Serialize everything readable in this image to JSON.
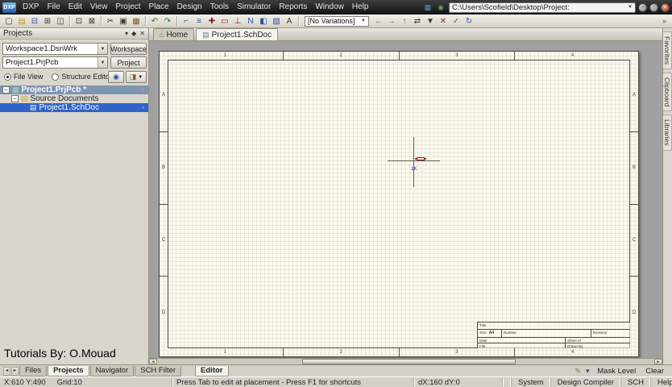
{
  "colors": {
    "selection_blue": "#2e63c8",
    "inactive_selection": "#7d96b4",
    "sheet_background": "#fbfaee",
    "canvas_gray": "#a0a0a0",
    "titlebar_background": "#1a1a1a"
  },
  "titlebar": {
    "logo": "DXP",
    "menus": [
      "DXP",
      "File",
      "Edit",
      "View",
      "Project",
      "Place",
      "Design",
      "Tools",
      "Simulator",
      "Reports",
      "Window",
      "Help"
    ],
    "quick_icons": [
      {
        "name": "workspace-quick-icon",
        "glyph": "▦",
        "color": "#5a8fd4"
      },
      {
        "name": "favorites-quick-icon",
        "glyph": "◉",
        "color": "#5fa05f"
      }
    ],
    "path_value": "C:\\Users\\Scofield\\Desktop\\Project:",
    "window_controls": [
      {
        "name": "minimize-button",
        "glyph": "–"
      },
      {
        "name": "restore-button",
        "glyph": "▫"
      },
      {
        "name": "close-button",
        "glyph": "✕",
        "type": "red"
      }
    ]
  },
  "toolbar": {
    "icons": [
      {
        "name": "new-document-icon",
        "glyph": "▢",
        "color": "#3b3b3b"
      },
      {
        "name": "open-document-icon",
        "glyph": "▤",
        "color": "#c9972c"
      },
      {
        "name": "save-icon",
        "glyph": "⊟",
        "color": "#35558f"
      },
      {
        "name": "print-icon",
        "glyph": "⊞",
        "color": "#3b3b3b"
      },
      {
        "name": "print-preview-icon",
        "glyph": "◫",
        "color": "#3b3b3b"
      },
      {
        "type": "sep",
        "name": "toolbar-separator"
      },
      {
        "name": "zoom-window-icon",
        "glyph": "⊡",
        "color": "#3b3b3b"
      },
      {
        "name": "zoom-fit-icon",
        "glyph": "⊠",
        "color": "#3b3b3b"
      },
      {
        "type": "sep",
        "name": "toolbar-separator"
      },
      {
        "name": "cut-icon",
        "glyph": "✂",
        "color": "#3b3b3b"
      },
      {
        "name": "copy-icon",
        "glyph": "▣",
        "color": "#3b3b3b"
      },
      {
        "name": "paste-icon",
        "glyph": "▦",
        "color": "#7a5c2e"
      },
      {
        "type": "sep",
        "name": "toolbar-separator"
      },
      {
        "name": "undo-icon",
        "glyph": "↶",
        "color": "#2f6e2f"
      },
      {
        "name": "redo-icon",
        "glyph": "↷",
        "color": "#2f6e2f"
      },
      {
        "type": "sep",
        "name": "toolbar-separator"
      },
      {
        "name": "place-wire-icon",
        "glyph": "⌐",
        "color": "#2a52a0"
      },
      {
        "name": "place-bus-icon",
        "glyph": "≡",
        "color": "#2a52a0"
      },
      {
        "name": "place-junction-icon",
        "glyph": "✚",
        "color": "#8b2020"
      },
      {
        "name": "place-part-icon",
        "glyph": "▭",
        "color": "#8b2020"
      },
      {
        "name": "place-power-port-icon",
        "glyph": "⊥",
        "color": "#8b2020"
      },
      {
        "name": "place-net-label-icon",
        "glyph": "N",
        "color": "#2a52a0"
      },
      {
        "name": "place-port-icon",
        "glyph": "◧",
        "color": "#2a52a0"
      },
      {
        "name": "place-sheet-symbol-icon",
        "glyph": "▧",
        "color": "#2a52a0"
      },
      {
        "name": "place-text-icon",
        "glyph": "A",
        "color": "#3b3b3b"
      },
      {
        "type": "sep",
        "name": "toolbar-separator"
      }
    ],
    "variations_value": "[No Variations]",
    "icons_right": [
      {
        "name": "navigate-back-icon",
        "glyph": "←",
        "color": "#2f7d2f"
      },
      {
        "name": "navigate-forward-icon",
        "glyph": "→",
        "color": "#2f7d2f"
      },
      {
        "name": "up-hierarchy-icon",
        "glyph": "↑",
        "color": "#2f7d2f"
      },
      {
        "name": "cross-probe-icon",
        "glyph": "⇄",
        "color": "#3b3b3b"
      },
      {
        "name": "filter-icon",
        "glyph": "▼",
        "color": "#3b3b3b"
      },
      {
        "name": "clear-filter-icon",
        "glyph": "✕",
        "color": "#a02020"
      },
      {
        "name": "compile-icon",
        "glyph": "✓",
        "color": "#2f7d2f"
      },
      {
        "name": "refresh-icon",
        "glyph": "↻",
        "color": "#2a52a0"
      }
    ],
    "overflow": "»"
  },
  "projects_panel": {
    "title": "Projects",
    "header_icons": [
      {
        "name": "chevron-down-icon",
        "glyph": "▾"
      },
      {
        "name": "pin-icon",
        "glyph": "◆"
      },
      {
        "name": "close-icon",
        "glyph": "✕"
      }
    ],
    "workspace_value": "Workspace1.DsnWrk",
    "workspace_button": "Workspace",
    "project_value": "Project1.PrjPcb",
    "project_button": "Project",
    "file_view_label": "File View",
    "structure_editor_label": "Structure Editor",
    "tree": [
      {
        "name": "tree-item-project1-prjpcb",
        "label": "Project1.PrjPcb *",
        "level": 0,
        "expander": "−",
        "icon": "▦",
        "right_icon": "▪",
        "bg": "#7d96b4",
        "color": "#ffffff",
        "type": "project-row"
      },
      {
        "name": "tree-item-source-documents",
        "label": "Source Documents",
        "level": 1,
        "expander": "−",
        "icon": "▤",
        "type": "folder-row"
      },
      {
        "name": "tree-item-project1-schdoc",
        "label": "Project1.SchDoc",
        "level": 2,
        "icon": "▤",
        "right_icon": "▫",
        "bg": "#2e63c8",
        "color": "#ffffff",
        "type": "sheet-row"
      }
    ],
    "watermark": "Tutorials By: O.Mouad"
  },
  "doc_tabs": [
    {
      "name": "tab-home",
      "label": "Home",
      "icon": "⌂",
      "type": "home-tab"
    },
    {
      "name": "tab-project1-schdoc",
      "label": "Project1.SchDoc",
      "icon": "▤",
      "active": true
    }
  ],
  "sheet": {
    "zones_top": [
      "1",
      "2",
      "3",
      "4"
    ],
    "zones_bottom": [
      "1",
      "2",
      "3",
      "4"
    ],
    "zones_left": [
      "A",
      "B",
      "C",
      "D"
    ],
    "zones_right": [
      "A",
      "B",
      "C",
      "D"
    ],
    "component_value": "1K",
    "title_block": {
      "title_label": "Title",
      "size_label": "Size",
      "size_value": "A4",
      "number_label": "Number",
      "revision_label": "Revision",
      "date_label": "Date",
      "sheet_label": "Sheet of",
      "file_label": "File",
      "drawn_label": "Drawn By"
    }
  },
  "right_tabs": [
    {
      "name": "tab-favorites",
      "label": "Favorites"
    },
    {
      "name": "tab-clipboard",
      "label": "Clipboard"
    },
    {
      "name": "tab-libraries",
      "label": "Libraries"
    }
  ],
  "bottom_bar": {
    "tabs": [
      {
        "name": "tab-files",
        "label": "Files"
      },
      {
        "name": "tab-projects",
        "label": "Projects",
        "active": true
      },
      {
        "name": "tab-navigator",
        "label": "Navigator"
      },
      {
        "name": "tab-sch-filter",
        "label": "SCH Filter"
      }
    ],
    "editor_tab": "Editor",
    "mask_icons": [
      {
        "name": "highlight-pencil-icon",
        "glyph": "✎",
        "color": "#8a6d1a"
      },
      {
        "name": "mask-caret-icon",
        "glyph": "▾",
        "color": "#444444"
      }
    ],
    "mask_level_button": "Mask Level",
    "clear_button": "Clear"
  },
  "statusbar": {
    "coords": "X:610 Y:490",
    "grid": "Grid:10",
    "hint": "Press Tab to edit at placement - Press F1 for shortcuts",
    "delta": "dX:160 dY:0",
    "panels": [
      {
        "name": "status-panel-system",
        "label": "System"
      },
      {
        "name": "status-panel-design-compiler",
        "label": "Design Compiler"
      },
      {
        "name": "status-panel-sch",
        "label": "SCH"
      },
      {
        "name": "status-panel-help",
        "label": "Help"
      }
    ],
    "right_icon_glyph": "▦"
  }
}
